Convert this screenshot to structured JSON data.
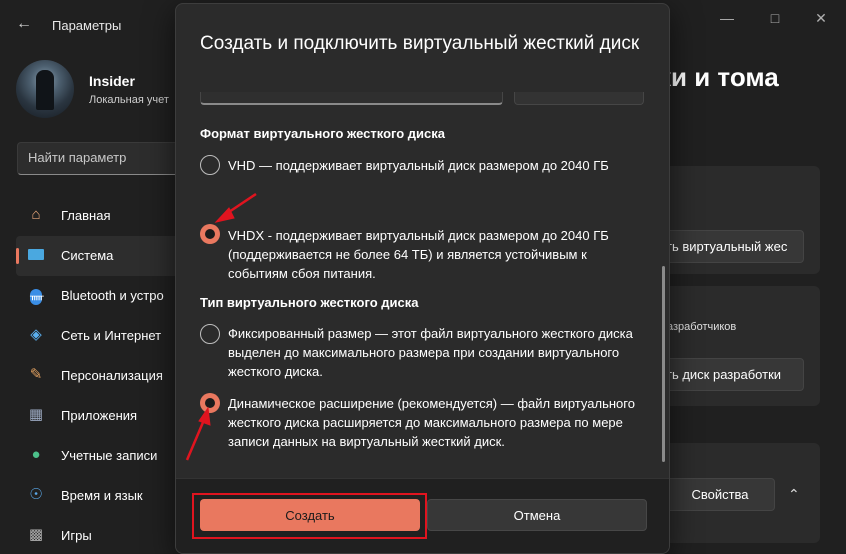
{
  "window": {
    "app_title": "Параметры",
    "back_icon": "arrow-left-icon",
    "minimize_icon": "minimize-icon",
    "maximize_icon": "maximize-icon",
    "close_icon": "close-icon"
  },
  "profile": {
    "name": "Insider",
    "subtitle": "Локальная учет"
  },
  "search": {
    "placeholder": "Найти параметр"
  },
  "sidebar": {
    "items": [
      {
        "label": "Главная",
        "icon": "home-icon"
      },
      {
        "label": "Система",
        "icon": "display-icon",
        "active": true
      },
      {
        "label": "Bluetooth и устро",
        "icon": "bluetooth-icon"
      },
      {
        "label": "Сеть и Интернет",
        "icon": "wifi-icon"
      },
      {
        "label": "Персонализация",
        "icon": "brush-icon"
      },
      {
        "label": "Приложения",
        "icon": "apps-icon"
      },
      {
        "label": "Учетные записи",
        "icon": "person-icon"
      },
      {
        "label": "Время и язык",
        "icon": "globe-clock-icon"
      },
      {
        "label": "Игры",
        "icon": "gamepad-icon"
      }
    ]
  },
  "background_page": {
    "title_fragment": "ки и тома",
    "buttons": [
      {
        "label": "ть виртуальный жес"
      },
      {
        "label": "ть диск разработки"
      },
      {
        "label": "Свойства"
      }
    ],
    "text_fragment": "азработчиков",
    "chevron_icon": "chevron-up-icon"
  },
  "dialog": {
    "title": "Создать и подключить виртуальный жесткий диск",
    "format_section": {
      "heading": "Формат виртуального жесткого диска",
      "options": [
        {
          "label": "VHD — поддерживает виртуальный диск размером до 2040 ГБ",
          "selected": false
        },
        {
          "label": "VHDX - поддерживает виртуальный диск размером до 2040 ГБ (поддерживается не более 64 ТБ) и является устойчивым к событиям сбоя питания.",
          "selected": true
        }
      ]
    },
    "type_section": {
      "heading": "Тип виртуального жесткого диска",
      "options": [
        {
          "label": "Фиксированный размер — этот файл виртуального жесткого диска выделен до максимального размера при создании виртуального жесткого диска.",
          "selected": false
        },
        {
          "label": "Динамическое расширение (рекомендуется) — файл виртуального жесткого диска расширяется до максимального размера по мере записи данных на виртуальный жесткий диск.",
          "selected": true
        }
      ]
    },
    "create_button": "Создать",
    "cancel_button": "Отмена"
  },
  "colors": {
    "accent": "#e9785f",
    "annotation_red": "#e0141f",
    "window_bg": "#202020",
    "dialog_bg": "#2b2b2b"
  }
}
